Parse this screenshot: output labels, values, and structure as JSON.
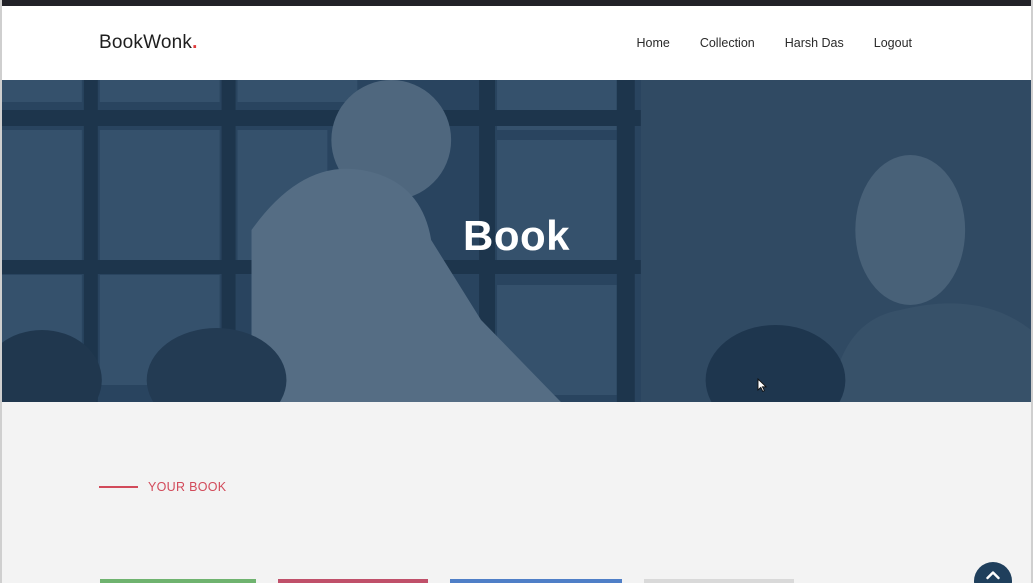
{
  "brand": {
    "name": "BookWonk",
    "dot": "."
  },
  "nav": {
    "items": [
      {
        "label": "Home"
      },
      {
        "label": "Collection"
      },
      {
        "label": "Harsh Das"
      },
      {
        "label": "Logout"
      }
    ]
  },
  "hero": {
    "title": "Book"
  },
  "section": {
    "label": "YOUR BOOK"
  },
  "colors": {
    "accent": "#d24a5a",
    "brand_dot": "#e03a3a",
    "hero_overlay": "#1c3752",
    "scroll_button": "#1f3f5c"
  },
  "icons": {
    "scroll_top": "chevron-up-icon",
    "cursor": "mouse-pointer-icon"
  }
}
